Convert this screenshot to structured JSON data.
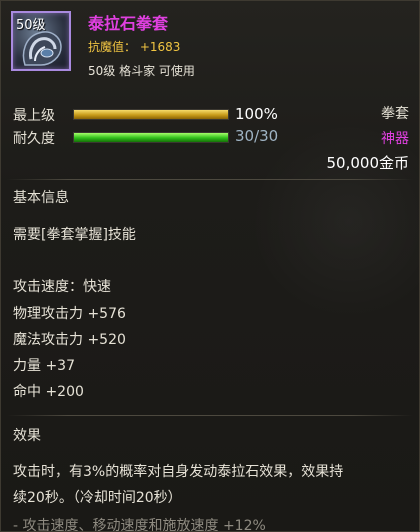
{
  "item": {
    "icon_level": "50级",
    "name": "泰拉石拳套",
    "stat_line": "抗魔值： +1683",
    "requirement": "50级 格斗家 可使用"
  },
  "bars": {
    "grade": {
      "label": "最上级",
      "value_text": "100%",
      "fill_percent": 100
    },
    "durability": {
      "label": "耐久度",
      "value_text": "30/30",
      "fill_percent": 100
    }
  },
  "right_info": {
    "type": "拳套",
    "rarity": "神器",
    "price": "50,000金币"
  },
  "colors": {
    "name": "#e040e0",
    "stat": "#f1c542",
    "rarity": "#e040e0",
    "durability_text": "#9fb4c4",
    "icon_border": "#a98adf"
  },
  "basic_info": {
    "title": "基本信息",
    "skill_req": "需要[拳套掌握]技能",
    "stats": [
      "攻击速度：快速",
      "物理攻击力 +576",
      "魔法攻击力 +520",
      "力量 +37",
      "命中 +200"
    ]
  },
  "effect": {
    "title": "效果",
    "lines": [
      "攻击时，有3%的概率对自身发动泰拉石效果，效果持",
      "续20秒。（冷却时间20秒）",
      "- 攻击速度、移动速度和施放速度 +12%"
    ]
  }
}
